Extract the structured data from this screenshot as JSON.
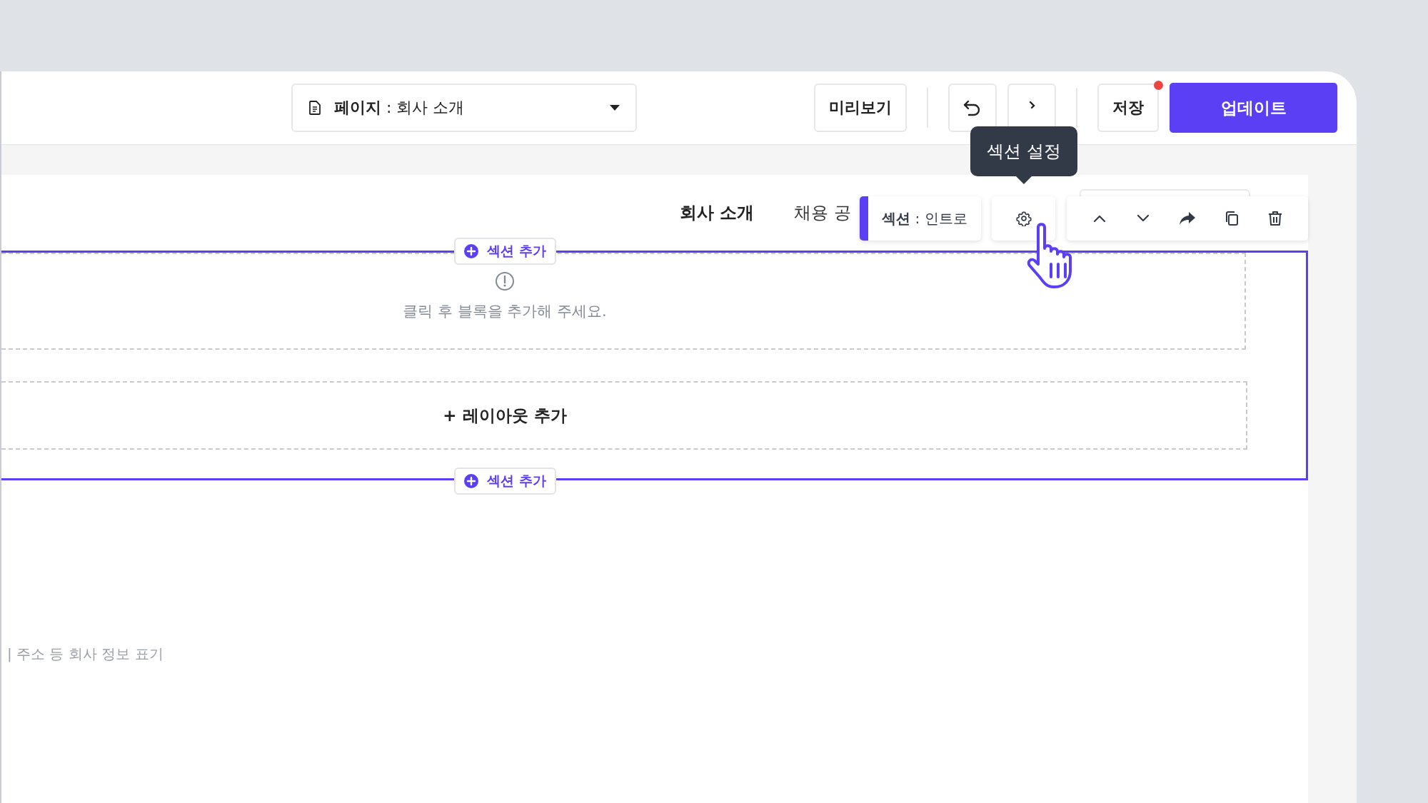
{
  "page_selector": {
    "label": "페이지",
    "separator": ":",
    "value": "회사 소개"
  },
  "header_buttons": {
    "preview": "미리보기",
    "save": "저장",
    "save_unsaved": true,
    "update": "업데이트"
  },
  "nav": [
    {
      "label": "회사 소개",
      "selected": true
    },
    {
      "label": "채용 공",
      "selected": false
    }
  ],
  "section_label": {
    "label": "섹션",
    "separator": ":",
    "value": "인트로"
  },
  "tooltip": "섹션 설정",
  "add_section": [
    "섹션 추가",
    "섹션 추가"
  ],
  "empty_block": "클릭 후 블록을 추가해 주세요.",
  "add_layout": "+ 레이아웃 추가",
  "footer_text": "| 주소 등 회사 정보 표기"
}
